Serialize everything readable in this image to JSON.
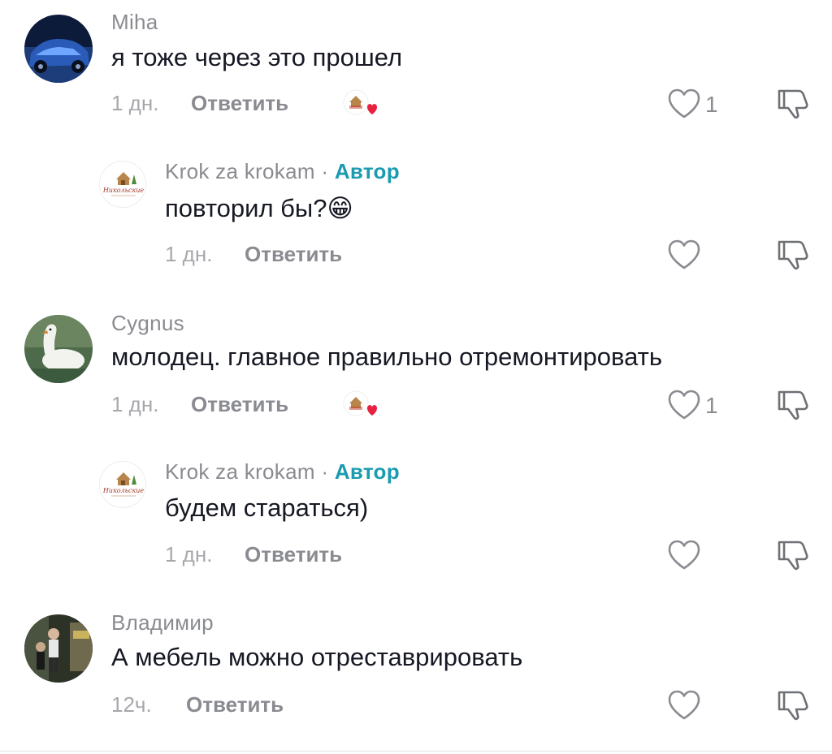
{
  "comments": [
    {
      "username": "Miha",
      "text": "я тоже через это прошел",
      "time": "1 дн.",
      "reply_label": "Ответить",
      "likes": "1",
      "creator_liked": true
    },
    {
      "username": "Krok za krokam",
      "separator": "·",
      "author_label": "Автор",
      "text": "повторил бы?😁",
      "time": "1 дн.",
      "reply_label": "Ответить",
      "avatar_text": "Никольские"
    },
    {
      "username": "Cygnus",
      "text": "молодец. главное правильно отремонтировать",
      "time": "1 дн.",
      "reply_label": "Ответить",
      "likes": "1",
      "creator_liked": true
    },
    {
      "username": "Krok za krokam",
      "separator": "·",
      "author_label": "Автор",
      "text": "будем стараться)",
      "time": "1 дн.",
      "reply_label": "Ответить",
      "avatar_text": "Никольские"
    },
    {
      "username": "Владимир",
      "text": "А мебель можно отреставрировать",
      "time": "12ч.",
      "reply_label": "Ответить"
    }
  ],
  "colors": {
    "author_accent": "#1a9bb0",
    "heart_badge": "#e8213f",
    "secondary_text": "#8a8b91"
  }
}
